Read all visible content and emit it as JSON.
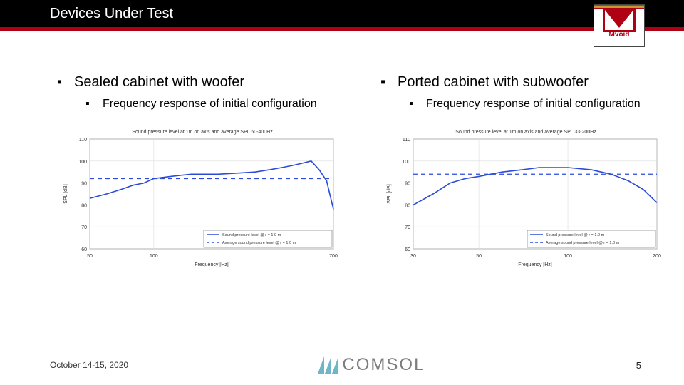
{
  "header": {
    "title": "Devices Under Test",
    "logo_brand": "Mvoid"
  },
  "columns": {
    "left": {
      "h1": "Sealed cabinet with woofer",
      "h2": "Frequency response of initial configuration"
    },
    "right": {
      "h1": "Ported cabinet with subwoofer",
      "h2": "Frequency response of initial configuration"
    }
  },
  "footer": {
    "date": "October 14-15, 2020",
    "center_brand": "COMSOL",
    "page": "5"
  },
  "chart_data": [
    {
      "type": "line",
      "title": "Sound pressure level at 1m on axis and average SPL 50-400Hz",
      "xlabel": "Frequency [Hz]",
      "ylabel": "SPL [dB]",
      "xscale": "log",
      "xlim": [
        50,
        700
      ],
      "ylim": [
        60,
        110
      ],
      "yticks": [
        60,
        70,
        80,
        90,
        100,
        110
      ],
      "xticks": [
        50,
        100,
        700
      ],
      "legend": [
        "Sound pressure level @ r = 1.0 m",
        "Average sound pressure level @ r = 1.0 m"
      ],
      "series": [
        {
          "name": "Sound pressure level @ r = 1.0 m",
          "style": "solid-blue",
          "x": [
            50,
            60,
            70,
            80,
            90,
            100,
            120,
            150,
            200,
            250,
            300,
            350,
            400,
            450,
            500,
            550,
            600,
            650,
            700
          ],
          "spl": [
            83,
            85,
            87,
            89,
            90,
            92,
            93,
            94,
            94,
            94.5,
            95,
            96,
            97,
            98,
            99,
            100,
            96,
            91,
            78
          ]
        },
        {
          "name": "Average sound pressure level @ r = 1.0 m",
          "style": "dashed-blue",
          "constant_spl": 92
        }
      ]
    },
    {
      "type": "line",
      "title": "Sound pressure level at 1m on axis and average SPL 33-200Hz",
      "xlabel": "Frequency [Hz]",
      "ylabel": "SPL [dB]",
      "xscale": "log",
      "xlim": [
        30,
        200
      ],
      "ylim": [
        60,
        110
      ],
      "yticks": [
        60,
        70,
        80,
        90,
        100,
        110
      ],
      "xticks": [
        30,
        50,
        100,
        200
      ],
      "legend": [
        "Sound pressure level @ r = 1.0 m",
        "Average sound pressure level @ r = 1.0 m"
      ],
      "series": [
        {
          "name": "Sound pressure level @ r = 1.0 m",
          "style": "solid-blue",
          "x": [
            30,
            35,
            40,
            45,
            50,
            60,
            70,
            80,
            90,
            100,
            120,
            140,
            160,
            180,
            200
          ],
          "spl": [
            80,
            85,
            90,
            92,
            93,
            95,
            96,
            97,
            97,
            97,
            96,
            94,
            91,
            87,
            81
          ]
        },
        {
          "name": "Average sound pressure level @ r = 1.0 m",
          "style": "dashed-blue",
          "constant_spl": 94
        }
      ]
    }
  ]
}
